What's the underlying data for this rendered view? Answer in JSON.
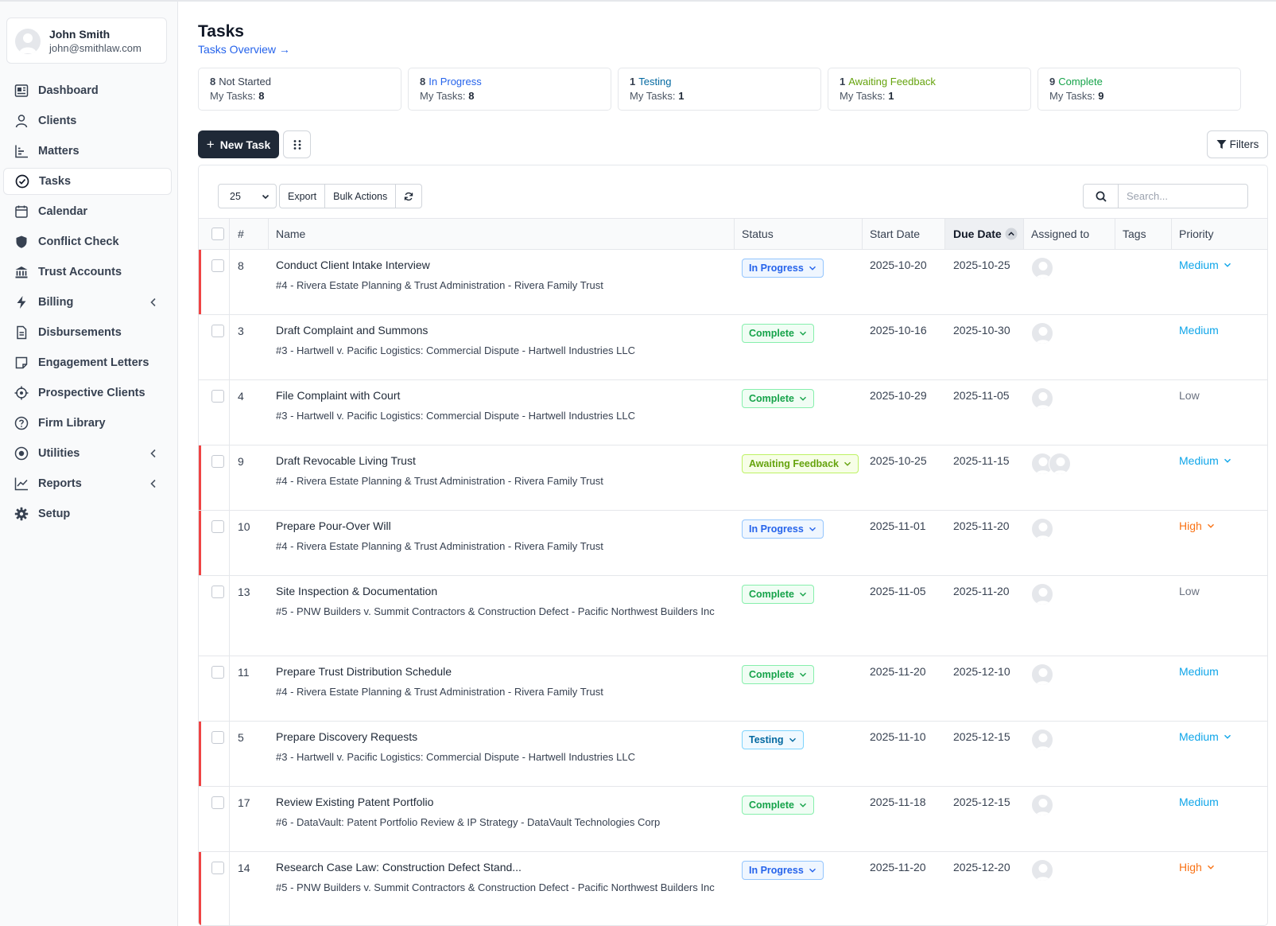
{
  "user": {
    "name": "John Smith",
    "email": "john@smithlaw.com"
  },
  "nav": [
    {
      "label": "Dashboard",
      "icon": "dashboard-icon"
    },
    {
      "label": "Clients",
      "icon": "user-icon"
    },
    {
      "label": "Matters",
      "icon": "matters-icon"
    },
    {
      "label": "Tasks",
      "icon": "check-circle-icon",
      "active": true
    },
    {
      "label": "Calendar",
      "icon": "calendar-icon"
    },
    {
      "label": "Conflict Check",
      "icon": "shield-icon"
    },
    {
      "label": "Trust Accounts",
      "icon": "bank-icon"
    },
    {
      "label": "Billing",
      "icon": "bolt-icon",
      "chevron": true
    },
    {
      "label": "Disbursements",
      "icon": "document-icon"
    },
    {
      "label": "Engagement Letters",
      "icon": "note-icon"
    },
    {
      "label": "Prospective Clients",
      "icon": "crosshair-icon"
    },
    {
      "label": "Firm Library",
      "icon": "question-circle-icon"
    },
    {
      "label": "Utilities",
      "icon": "dot-circle-icon",
      "chevron": true
    },
    {
      "label": "Reports",
      "icon": "chart-line-icon",
      "chevron": true
    },
    {
      "label": "Setup",
      "icon": "gear-icon"
    }
  ],
  "page": {
    "title": "Tasks",
    "overview_link": "Tasks Overview →"
  },
  "stats": [
    {
      "count": "8",
      "label": "Not Started",
      "my": "My Tasks:",
      "my_count": "8",
      "color": "#374151"
    },
    {
      "count": "8",
      "label": "In Progress",
      "my": "My Tasks:",
      "my_count": "8",
      "color": "#2563eb"
    },
    {
      "count": "1",
      "label": "Testing",
      "my": "My Tasks:",
      "my_count": "1",
      "color": "#0369a1"
    },
    {
      "count": "1",
      "label": "Awaiting Feedback",
      "my": "My Tasks:",
      "my_count": "1",
      "color": "#65a30d"
    },
    {
      "count": "9",
      "label": "Complete",
      "my": "My Tasks:",
      "my_count": "9",
      "color": "#16a34a"
    }
  ],
  "toolbar": {
    "new_task": "New Task",
    "filters": "Filters",
    "page_size": "25",
    "export": "Export",
    "bulk_actions": "Bulk Actions",
    "search_placeholder": "Search..."
  },
  "columns": {
    "num": "#",
    "name": "Name",
    "status": "Status",
    "start": "Start Date",
    "due": "Due Date",
    "assigned": "Assigned to",
    "tags": "Tags",
    "priority": "Priority"
  },
  "tasks": [
    {
      "num": "8",
      "name": "Conduct Client Intake Interview",
      "matter": "#4 - Rivera Estate Planning & Trust Administration - Rivera Family Trust",
      "status": "In Progress",
      "status_class": "b-inprogress",
      "start": "2025-10-20",
      "due": "2025-10-25",
      "assignees": 1,
      "priority": "Medium",
      "priority_class": "p-medium",
      "priority_chevron": true,
      "flag": true
    },
    {
      "num": "3",
      "name": "Draft Complaint and Summons",
      "matter": "#3 - Hartwell v. Pacific Logistics: Commercial Dispute - Hartwell Industries LLC",
      "status": "Complete",
      "status_class": "b-complete",
      "start": "2025-10-16",
      "due": "2025-10-30",
      "assignees": 1,
      "priority": "Medium",
      "priority_class": "p-medium",
      "priority_chevron": false,
      "flag": false
    },
    {
      "num": "4",
      "name": "File Complaint with Court",
      "matter": "#3 - Hartwell v. Pacific Logistics: Commercial Dispute - Hartwell Industries LLC",
      "status": "Complete",
      "status_class": "b-complete",
      "start": "2025-10-29",
      "due": "2025-11-05",
      "assignees": 1,
      "priority": "Low",
      "priority_class": "p-low",
      "priority_chevron": false,
      "flag": false
    },
    {
      "num": "9",
      "name": "Draft Revocable Living Trust",
      "matter": "#4 - Rivera Estate Planning & Trust Administration - Rivera Family Trust",
      "status": "Awaiting Feedback",
      "status_class": "b-awaiting",
      "start": "2025-10-25",
      "due": "2025-11-15",
      "assignees": 2,
      "priority": "Medium",
      "priority_class": "p-medium",
      "priority_chevron": true,
      "flag": true
    },
    {
      "num": "10",
      "name": "Prepare Pour-Over Will",
      "matter": "#4 - Rivera Estate Planning & Trust Administration - Rivera Family Trust",
      "status": "In Progress",
      "status_class": "b-inprogress",
      "start": "2025-11-01",
      "due": "2025-11-20",
      "assignees": 1,
      "priority": "High",
      "priority_class": "p-high",
      "priority_chevron": true,
      "flag": true
    },
    {
      "num": "13",
      "name": "Site Inspection & Documentation",
      "matter": "#5 - PNW Builders v. Summit Contractors & Construction Defect - Pacific Northwest Builders Inc",
      "status": "Complete",
      "status_class": "b-complete",
      "start": "2025-11-05",
      "due": "2025-11-20",
      "assignees": 1,
      "priority": "Low",
      "priority_class": "p-low",
      "priority_chevron": false,
      "flag": false
    },
    {
      "num": "11",
      "name": "Prepare Trust Distribution Schedule",
      "matter": "#4 - Rivera Estate Planning & Trust Administration - Rivera Family Trust",
      "status": "Complete",
      "status_class": "b-complete",
      "start": "2025-11-20",
      "due": "2025-12-10",
      "assignees": 1,
      "priority": "Medium",
      "priority_class": "p-medium",
      "priority_chevron": false,
      "flag": false
    },
    {
      "num": "5",
      "name": "Prepare Discovery Requests",
      "matter": "#3 - Hartwell v. Pacific Logistics: Commercial Dispute - Hartwell Industries LLC",
      "status": "Testing",
      "status_class": "b-testing",
      "start": "2025-11-10",
      "due": "2025-12-15",
      "assignees": 1,
      "priority": "Medium",
      "priority_class": "p-medium",
      "priority_chevron": true,
      "flag": true
    },
    {
      "num": "17",
      "name": "Review Existing Patent Portfolio",
      "matter": "#6 - DataVault: Patent Portfolio Review & IP Strategy - DataVault Technologies Corp",
      "status": "Complete",
      "status_class": "b-complete",
      "start": "2025-11-18",
      "due": "2025-12-15",
      "assignees": 1,
      "priority": "Medium",
      "priority_class": "p-medium",
      "priority_chevron": false,
      "flag": false
    },
    {
      "num": "14",
      "name": "Research Case Law: Construction Defect Stand...",
      "matter": "#5 - PNW Builders v. Summit Contractors & Construction Defect - Pacific Northwest Builders Inc",
      "status": "In Progress",
      "status_class": "b-inprogress",
      "start": "2025-11-20",
      "due": "2025-12-20",
      "assignees": 1,
      "priority": "High",
      "priority_class": "p-high",
      "priority_chevron": true,
      "flag": true
    }
  ]
}
